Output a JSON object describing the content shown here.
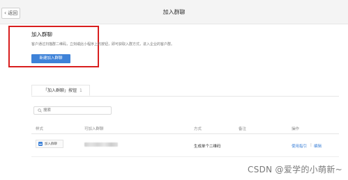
{
  "header": {
    "back_label": "返回",
    "title": "加入群聊"
  },
  "card": {
    "title": "加入群聊",
    "description": "客户通过扫描群二维码，立刻或此小程序上的按钮，即可获取入群方式，进入企业的客户群。",
    "create_button": "新建加入群聊"
  },
  "tabs": [
    {
      "label": "「加入群聊」按钮",
      "count": "1"
    }
  ],
  "search": {
    "placeholder": "搜索"
  },
  "table": {
    "columns": [
      "样式",
      "可加入群聊",
      "方式",
      "备注",
      "操作"
    ],
    "rows": [
      {
        "style_label": "加入群聊",
        "method": "生成单个二维码",
        "note": "",
        "actions": [
          "使用指引",
          "编辑"
        ],
        "action_separator": "|"
      }
    ]
  },
  "watermark": "CSDN @爱学的小萌新~",
  "colors": {
    "accent": "#3e82d8",
    "highlight_border": "#d81e1e"
  }
}
